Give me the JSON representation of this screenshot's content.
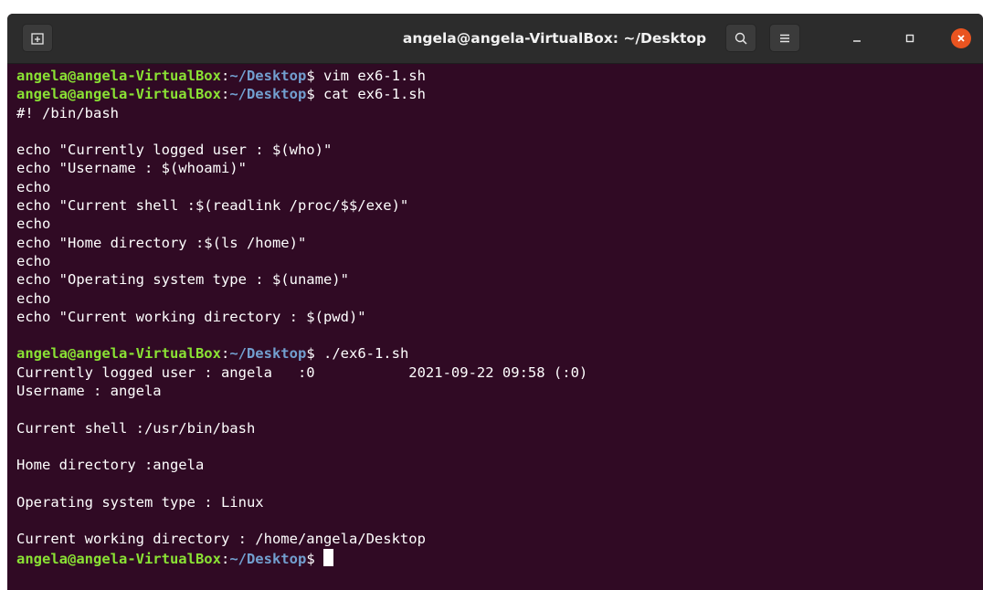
{
  "window": {
    "title": "angela@angela-VirtualBox: ~/Desktop"
  },
  "prompt": {
    "user_host": "angela@angela-VirtualBox",
    "sep": ":",
    "path": "~/Desktop",
    "symbol": "$"
  },
  "lines": [
    {
      "kind": "prompt",
      "cmd": " vim ex6-1.sh"
    },
    {
      "kind": "prompt",
      "cmd": " cat ex6-1.sh"
    },
    {
      "kind": "text",
      "text": "#! /bin/bash"
    },
    {
      "kind": "text",
      "text": ""
    },
    {
      "kind": "text",
      "text": "echo \"Currently logged user : $(who)\""
    },
    {
      "kind": "text",
      "text": "echo \"Username : $(whoami)\""
    },
    {
      "kind": "text",
      "text": "echo"
    },
    {
      "kind": "text",
      "text": "echo \"Current shell :$(readlink /proc/$$/exe)\""
    },
    {
      "kind": "text",
      "text": "echo"
    },
    {
      "kind": "text",
      "text": "echo \"Home directory :$(ls /home)\""
    },
    {
      "kind": "text",
      "text": "echo"
    },
    {
      "kind": "text",
      "text": "echo \"Operating system type : $(uname)\""
    },
    {
      "kind": "text",
      "text": "echo"
    },
    {
      "kind": "text",
      "text": "echo \"Current working directory : $(pwd)\""
    },
    {
      "kind": "text",
      "text": ""
    },
    {
      "kind": "prompt",
      "cmd": " ./ex6-1.sh"
    },
    {
      "kind": "text",
      "text": "Currently logged user : angela   :0           2021-09-22 09:58 (:0)"
    },
    {
      "kind": "text",
      "text": "Username : angela"
    },
    {
      "kind": "text",
      "text": ""
    },
    {
      "kind": "text",
      "text": "Current shell :/usr/bin/bash"
    },
    {
      "kind": "text",
      "text": ""
    },
    {
      "kind": "text",
      "text": "Home directory :angela"
    },
    {
      "kind": "text",
      "text": ""
    },
    {
      "kind": "text",
      "text": "Operating system type : Linux"
    },
    {
      "kind": "text",
      "text": ""
    },
    {
      "kind": "text",
      "text": "Current working directory : /home/angela/Desktop"
    },
    {
      "kind": "prompt",
      "cmd": " ",
      "cursor": true
    }
  ],
  "colors": {
    "background": "#300a24",
    "user_host": "#8ae234",
    "path": "#729fcf",
    "text": "#ffffff",
    "titlebar": "#2c2c2c",
    "close": "#e95420"
  },
  "icons": {
    "new_tab": "new-tab-icon",
    "search": "search-icon",
    "menu": "hamburger-menu-icon",
    "minimize": "minimize-icon",
    "maximize": "maximize-icon",
    "close": "close-icon"
  }
}
